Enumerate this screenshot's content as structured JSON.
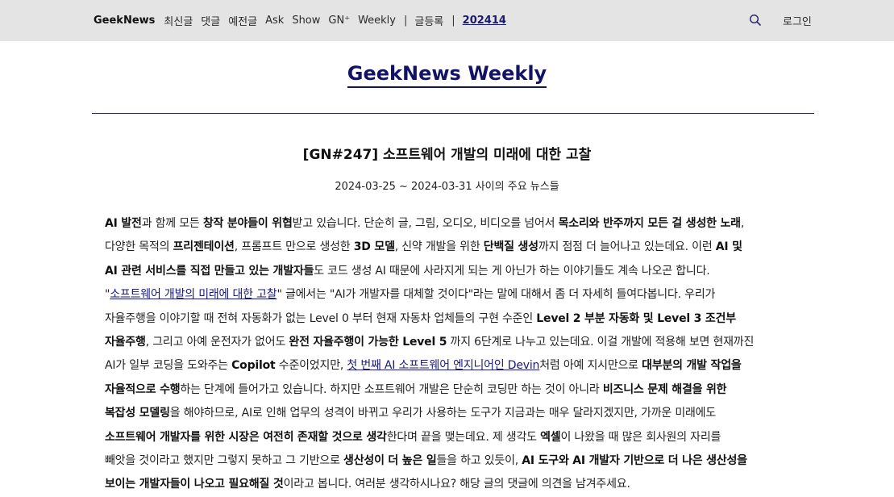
{
  "nav": {
    "brand": "GeekNews",
    "items": [
      "최신글",
      "댓글",
      "예전글",
      "Ask",
      "Show",
      "GN⁺",
      "Weekly"
    ],
    "sep1": "|",
    "submit": "글등록",
    "sep2": "|",
    "issue": "202414",
    "login": "로그인"
  },
  "page": {
    "title": "GeekNews Weekly",
    "article_title": "[GN#247] 소프트웨어 개발의 미래에 대한 고찰",
    "dates": "2024-03-25 ~ 2024-03-31 사이의 주요 뉴스들"
  },
  "body": {
    "l1": [
      "AI 발전",
      "과 함께 모든 ",
      "창작 분야들이 위협",
      "받고 있습니다. 단순히 글, 그림, 오디오, 비디오를 넘어서 ",
      "목소리와 반주까지 모든 걸 생성한 노래",
      ","
    ],
    "l2": [
      "다양한 목적의 ",
      "프리젠테이션",
      ", 프롬프트 만으로 생성한 ",
      "3D 모델",
      ", 신약 개발을 위한 ",
      "단백질 생성",
      "까지 점점 더 늘어나고 있는데요. 이런 ",
      "AI 및"
    ],
    "l3": [
      "AI 관련 서비스를 직접 만들고 있는 개발자들",
      "도 코드 생성 AI 때문에 사라지게 되는 게 아닌가 하는 이야기들도 계속 나오곤 합니다."
    ],
    "l4": [
      "\"",
      "소프트웨어 개발의 미래에 대한 고찰",
      "\" 글에서는 \"AI가 개발자를 대체할 것이다\"라는 말에 대해서 좀 더 자세히 들여다봅니다. 우리가"
    ],
    "l5": [
      "자율주행을 이야기할 때 전혀 자동화가 없는 Level 0 부터 현재 자동차 업체들의 구현 수준인 ",
      "Level 2 부분 자동화 및 Level 3 조건부"
    ],
    "l6": [
      "자율주행",
      ", 그리고 아예 운전자가 없어도 ",
      "완전 자율주행이 가능한 Level 5",
      " 까지 6단계로 나누고 있는데요. 이걸 개발에 적용해 보면 현재까진"
    ],
    "l7": [
      "AI가 일부 코딩을 도와주는 ",
      "Copilot",
      " 수준이었지만, ",
      "첫 번째 AI 소프트웨어 엔지니어인 Devin",
      "처럼 아예 지시만으로 ",
      "대부분의 개발 작업을"
    ],
    "l8": [
      "자율적으로 수행",
      "하는 단계에 들어가고 있습니다. 하지만 소프트웨어 개발은 단순히 코딩만 하는 것이 아니라 ",
      "비즈니스 문제 해결을 위한"
    ],
    "l9": [
      "복잡성 모델링",
      "을 해야하므로, AI로 인해 업무의 성격이 바뀌고 우리가 사용하는 도구가 지금과는 매우 달라지겠지만, 가까운 미래에도"
    ],
    "l10": [
      "소프트웨어 개발자를 위한 시장은 여전히 존재할 것으로 생각",
      "한다며 끝을 맺는데요. 제 생각도 ",
      "엑셀",
      "이 나왔을 때 많은 회사원의 자리를"
    ],
    "l11": [
      "빼앗을 것이라고 했지만 그렇지 못하고 그 기반으로 ",
      "생산성이 더 높은 일",
      "들을 하고 있듯이, ",
      "AI 도구와 AI 개발자 기반으로 더 나은 생산성을"
    ],
    "l12": [
      "보이는 개발자들이 나오고 필요해질 것",
      "이라고 봅니다. 여러분 생각하시나요? 해당 글의 댓글에 의견을 남겨주세요."
    ]
  },
  "colors": {
    "topbar": "#e4e4e4",
    "accent": "#131366",
    "link": "#18187a"
  }
}
